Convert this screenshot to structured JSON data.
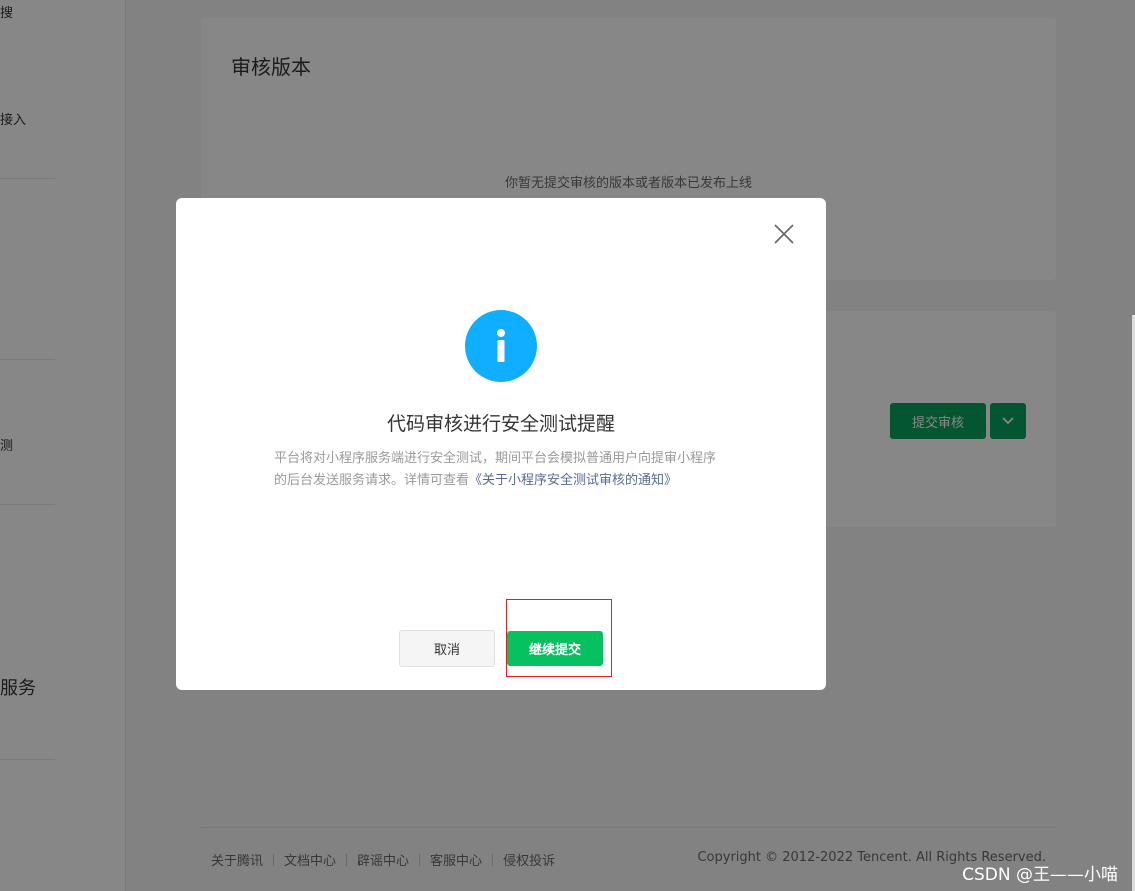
{
  "sidebar": {
    "items": [
      "搜",
      "接入",
      "测",
      "服务"
    ]
  },
  "audit_card": {
    "title": "审核版本",
    "empty_text": "你暂无提交审核的版本或者版本已发布上线"
  },
  "dev_card": {
    "submit_label": "提交审核"
  },
  "footer": {
    "links": [
      "关于腾讯",
      "文档中心",
      "辟谣中心",
      "客服中心",
      "侵权投诉"
    ],
    "copyright": "Copyright © 2012-2022 Tencent. All Rights Reserved."
  },
  "dialog": {
    "title": "代码审核进行安全测试提醒",
    "body": "平台将对小程序服务端进行安全测试，期间平台会模拟普通用户向提审小程序的后台发送服务请求。详情可查看",
    "link_text": "《关于小程序安全测试审核的通知》",
    "cancel_label": "取消",
    "continue_label": "继续提交"
  },
  "watermark": "CSDN @王——小喵",
  "colors": {
    "primary_green": "#07c160",
    "info_blue": "#10aeff",
    "highlight_red": "#e02020",
    "link_blue": "#576b95"
  }
}
